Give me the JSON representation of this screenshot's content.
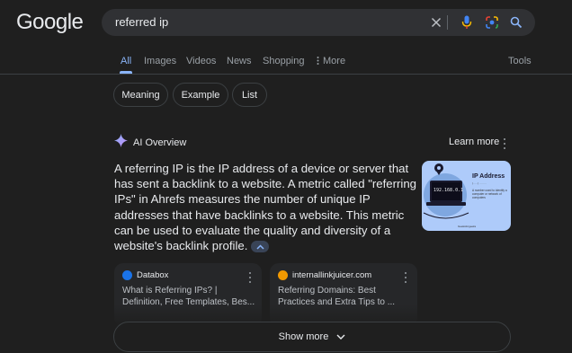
{
  "header": {
    "logo": "Google",
    "search_value": "referred ip"
  },
  "tabs": [
    {
      "label": "All",
      "active": true
    },
    {
      "label": "Images"
    },
    {
      "label": "Videos"
    },
    {
      "label": "News"
    },
    {
      "label": "Shopping"
    },
    {
      "label": "More"
    }
  ],
  "tools_label": "Tools",
  "chips": [
    "Meaning",
    "Example",
    "List"
  ],
  "ai_overview": {
    "title": "AI Overview",
    "learn_more": "Learn more",
    "text": "A referring IP is the IP address of a device or server that has sent a backlink to a website. A metric called \"referring IPs\" in Ahrefs measures the number of unique IP addresses that have backlinks to a website. This metric can be used to evaluate the quality and diversity of a website's backlink profile.",
    "thumbnail": {
      "title": "IP Address",
      "subtitle": "(·····) ········",
      "description": "A number used to identify a computer or network of computers",
      "screen_text": "192.168.0.1",
      "footer": "Geeksforgeeks"
    }
  },
  "sources": [
    {
      "site": "Databox",
      "title": "What is Referring IPs? | Definition, Free Templates, Bes...",
      "favicon_color": "#1a73e8"
    },
    {
      "site": "internallinkjuicer.com",
      "title": "Referring Domains: Best Practices and Extra Tips to ...",
      "favicon_color": "#f29900"
    }
  ],
  "show_more": "Show more",
  "colors": {
    "accent": "#8ab4f8",
    "background": "#1f1f1f",
    "surface": "#303134"
  }
}
